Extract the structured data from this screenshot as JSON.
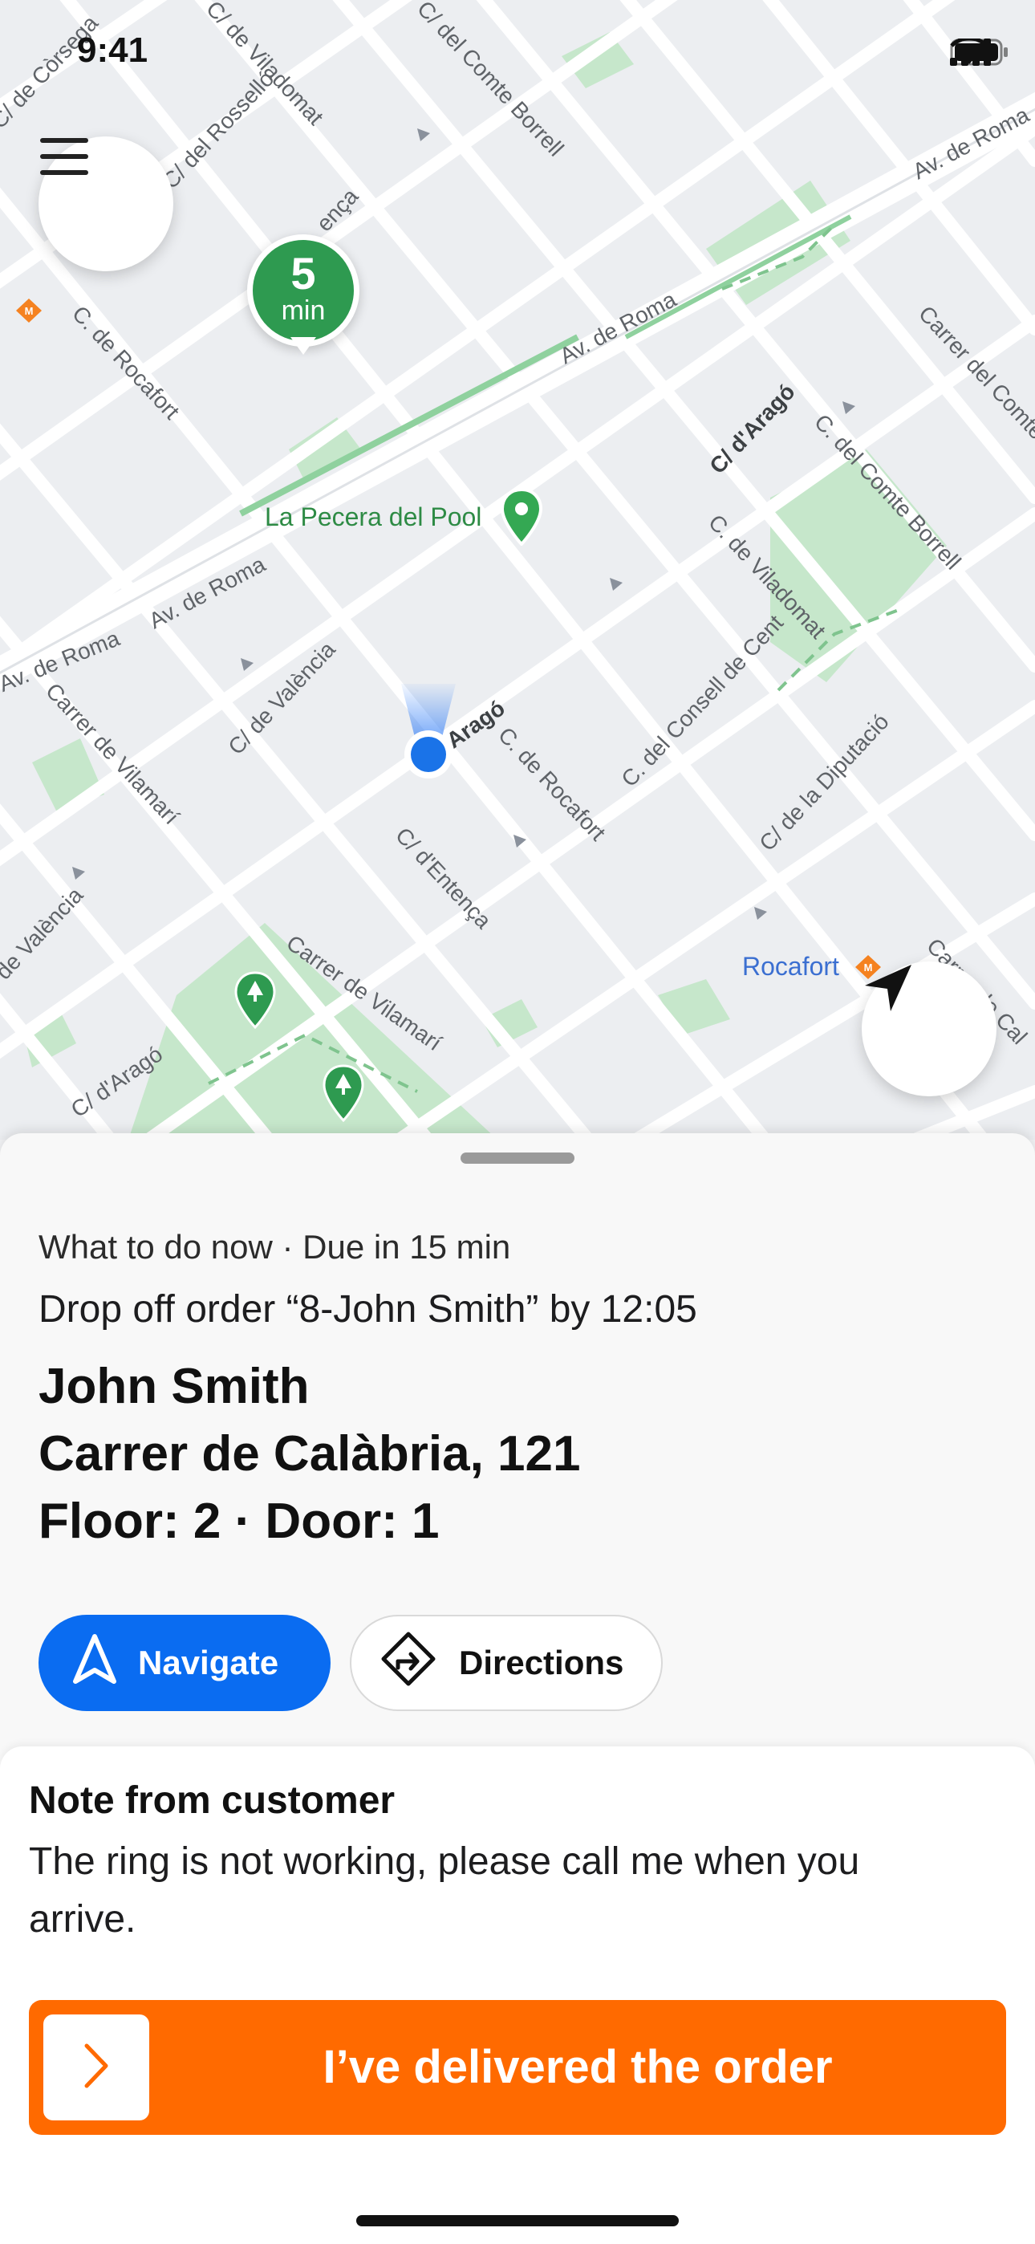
{
  "status_bar": {
    "time": "9:41"
  },
  "map": {
    "eta": {
      "value": "5",
      "unit": "min"
    },
    "poi": {
      "name": "La Pecera del Pool"
    },
    "metro": {
      "name": "Rocafort"
    },
    "streets": {
      "s1": "C/ de Viladomat",
      "s2": "C/ del Comte Borrell",
      "s3": "C/ de Còrsega",
      "s4": "C/ del Rosselló",
      "s5": "C. de Rocafort",
      "s6": "Av. de Roma",
      "s7": "Carrer del Comte",
      "s8": "C/ d'Aragó",
      "s9": "C. del Comte Borrell",
      "s10": "C. de Viladomat",
      "s11": "Av. de Roma",
      "s12": "C/ de València",
      "s13": "Carrer de Vilamarí",
      "s14": "C. de Rocafort",
      "s15": "C. del Consell de Cent",
      "s16": "C/ de la Diputació",
      "s17": "C/ d'Entença",
      "s18": "Carrer de Vilamarí",
      "s19": "C/ d'Aragó",
      "s20": "de València",
      "s21": "Av. de Roma",
      "s22": "Carrer de Cal",
      "s23": "Aragó",
      "s24": "ença",
      "s25": "Av. de Roma"
    }
  },
  "sheet": {
    "meta": "What to do now · Due in 15 min",
    "title": "Drop off order “8-John Smith” by 12:05",
    "customer_name": "John Smith",
    "address_line": "Carrer de Calàbria, 121",
    "floor_door": "Floor: 2 · Door: 1",
    "navigate_label": "Navigate",
    "directions_label": "Directions"
  },
  "note": {
    "title": "Note from customer",
    "text": "The ring is not working, please call me when you arrive."
  },
  "action": {
    "deliver_label": "I’ve delivered the order"
  },
  "colors": {
    "primary_blue": "#0a6cf1",
    "accent_orange": "#ff6a00",
    "eta_green": "#2e9a50",
    "park_green": "#c3e5c8"
  },
  "icons": [
    "menu-icon",
    "navigation-arrow-icon",
    "directions-diamond-icon",
    "chevron-right-icon",
    "location-pin-icon",
    "metro-icon",
    "tree-icon",
    "signal-icon",
    "wifi-icon",
    "battery-icon"
  ]
}
